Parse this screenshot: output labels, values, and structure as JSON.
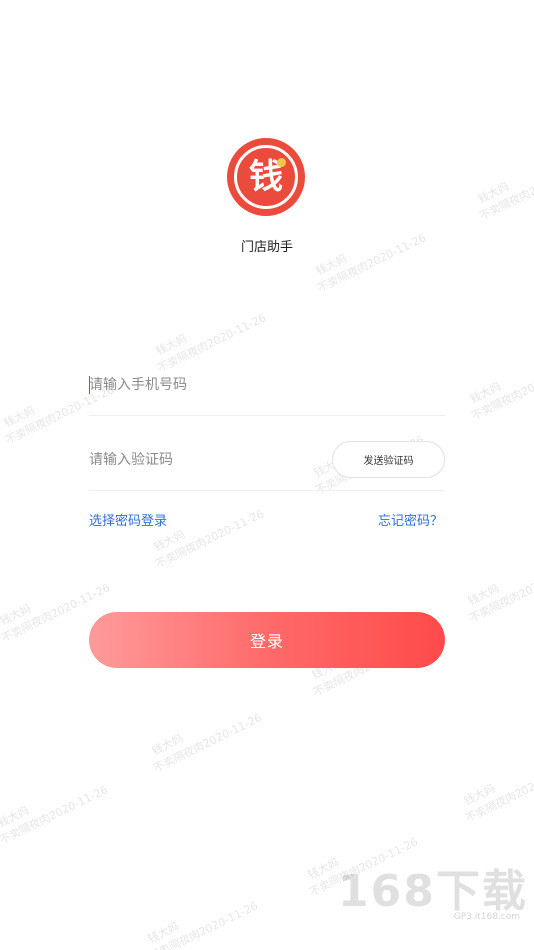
{
  "app": {
    "logo_char": "钱",
    "name": "门店助手"
  },
  "login": {
    "phone_placeholder": "请输入手机号码",
    "code_placeholder": "请输入验证码",
    "send_code_label": "发送验证码",
    "password_login_link": "选择密码登录",
    "forgot_password_link": "忘记密码？",
    "login_button": "登录"
  },
  "watermark": {
    "line1": "钱大妈",
    "line2": "不卖隔夜肉2020-11-26"
  },
  "badge": {
    "big": "168下载",
    "small": "GP3.it168.com"
  },
  "colors": {
    "brand_red": "#ea4b3d",
    "link_blue": "#2f6fd6",
    "button_gradient_start": "#ff9a9a",
    "button_gradient_end": "#ff4a4a"
  }
}
